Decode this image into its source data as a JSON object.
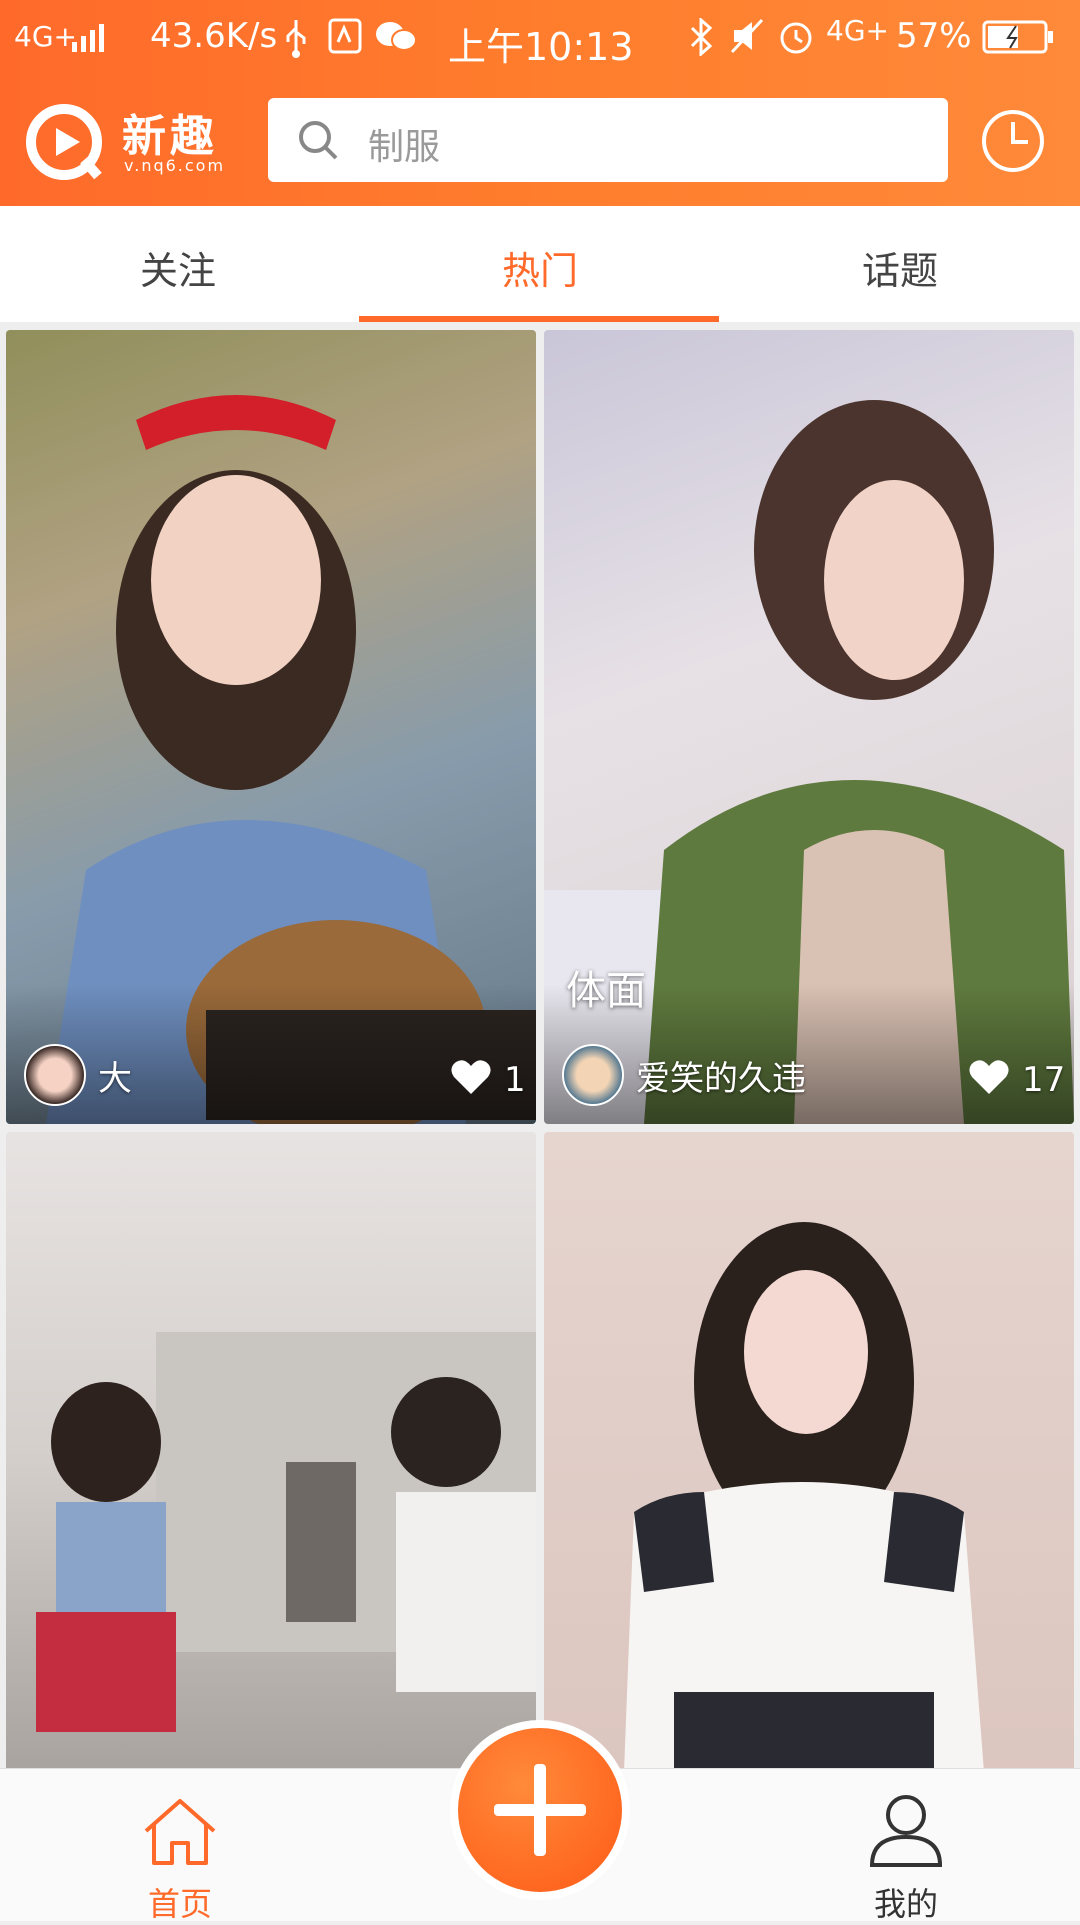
{
  "status_bar": {
    "network": "4G+",
    "speed": "43.6K/s",
    "time": "上午10:13",
    "network_right": "4G+",
    "battery": "57%"
  },
  "header": {
    "logo_text": "新趣",
    "logo_sub": "v.nq6.com",
    "search_placeholder": "制服",
    "accent_color": "#ff6a2b"
  },
  "tabs": [
    {
      "label": "关注",
      "active": false
    },
    {
      "label": "热门",
      "active": true
    },
    {
      "label": "话题",
      "active": false
    }
  ],
  "feed": [
    {
      "user": "大",
      "likes": "1",
      "caption": ""
    },
    {
      "user": "爱笑的久违",
      "likes": "17",
      "caption": "体面"
    },
    {
      "user": "",
      "likes": "",
      "caption": ""
    },
    {
      "user": "",
      "likes": "",
      "caption": ""
    }
  ],
  "bottom_nav": {
    "home_label": "首页",
    "me_label": "我的",
    "add_icon": "plus-icon"
  }
}
